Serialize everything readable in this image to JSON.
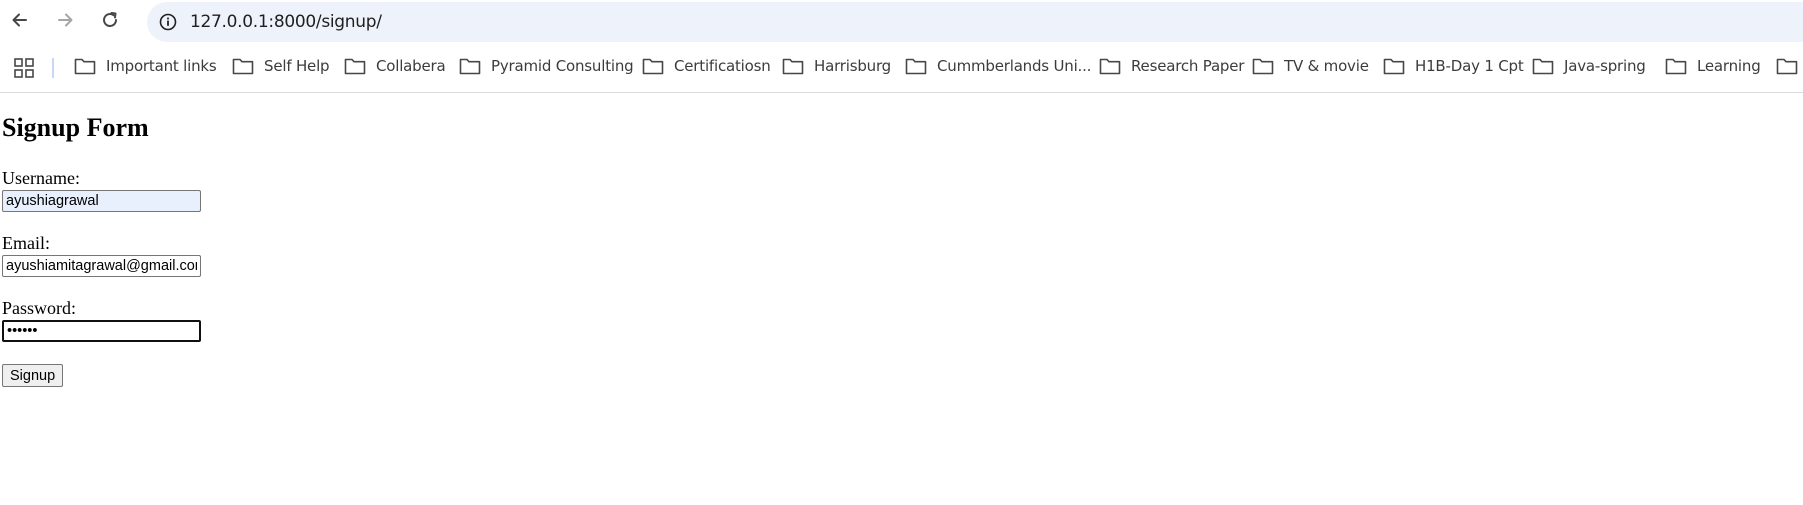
{
  "browser": {
    "url": "127.0.0.1:8000/signup/",
    "icons": {
      "back": "arrow-left-icon",
      "forward": "arrow-right-icon",
      "reload": "reload-icon",
      "site_info": "info-circle-icon",
      "apps": "apps-grid-icon",
      "folder": "folder-icon"
    },
    "bookmarks": [
      "Important links",
      "Self Help",
      "Collabera",
      "Pyramid Consulting",
      "Certificatiosn",
      "Harrisburg",
      "Cummberlands Uni...",
      "Research Paper",
      "TV & movie",
      "H1B-Day 1 Cpt",
      "Java-spring",
      "Learning"
    ]
  },
  "form": {
    "title": "Signup Form",
    "username_label": "Username:",
    "username_value": "ayushiagrawal",
    "email_label": "Email:",
    "email_value": "ayushiamitagrawal@gmail.com",
    "password_label": "Password:",
    "password_value": "••••••",
    "submit_label": "Signup"
  },
  "colors": {
    "omnibox_bg": "#eef2fa",
    "autofill_bg": "#e8f0fe",
    "bookmark_icon": "#474747"
  }
}
